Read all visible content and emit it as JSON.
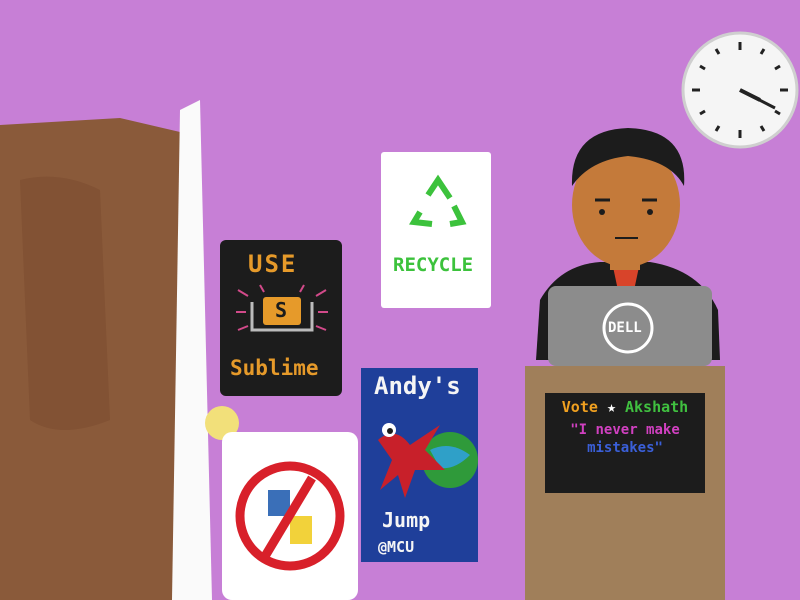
{
  "colors": {
    "wall": "#c77fd6",
    "door": "#8a5a3a",
    "podium": "#a07f5a",
    "sign_bg": "#1c1c1c",
    "sublime_orange": "#e69a2a",
    "recycle_green": "#3cc23c",
    "jump_blue": "#1f3f9a",
    "dragon_red": "#c8202a"
  },
  "posters": {
    "sublime": {
      "line1": "USE",
      "icon_letter": "S",
      "line2": "Sublime"
    },
    "recycle": {
      "label": "RECYCLE"
    },
    "jump": {
      "line1": "Andy's",
      "line2": "Jump",
      "line3": "@MCU"
    }
  },
  "laptop": {
    "brand": "DELL"
  },
  "podium_sign": {
    "vote": "Vote",
    "star": "★",
    "name": "Akshath",
    "quote_line1": "\"I never make",
    "quote_line2": "mistakes\""
  }
}
